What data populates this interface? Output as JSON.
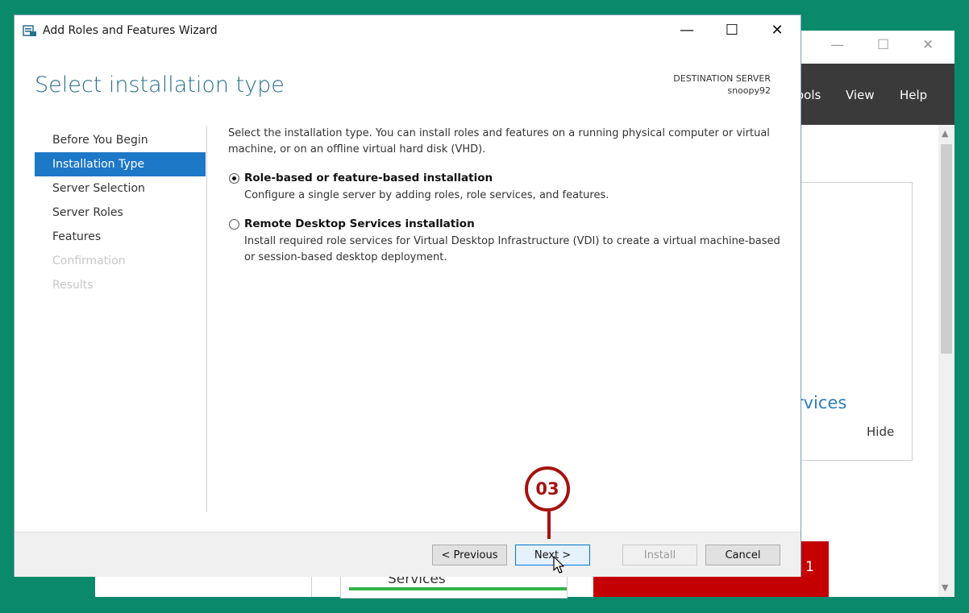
{
  "background_window": {
    "menu": [
      "ools",
      "View",
      "Help"
    ],
    "services_text": "rvices",
    "hide_label": "Hide",
    "tile_label": "Services",
    "red_tile_count": "1"
  },
  "wizard": {
    "title": "Add Roles and Features Wizard",
    "heading": "Select installation type",
    "destination_label": "DESTINATION SERVER",
    "destination_server": "snoopy92",
    "nav": [
      {
        "label": "Before You Begin",
        "state": "normal"
      },
      {
        "label": "Installation Type",
        "state": "active"
      },
      {
        "label": "Server Selection",
        "state": "normal"
      },
      {
        "label": "Server Roles",
        "state": "normal"
      },
      {
        "label": "Features",
        "state": "normal"
      },
      {
        "label": "Confirmation",
        "state": "disabled"
      },
      {
        "label": "Results",
        "state": "disabled"
      }
    ],
    "intro": "Select the installation type. You can install roles and features on a running physical computer or virtual machine, or on an offline virtual hard disk (VHD).",
    "options": [
      {
        "title": "Role-based or feature-based installation",
        "desc": "Configure a single server by adding roles, role services, and features.",
        "checked": true
      },
      {
        "title": "Remote Desktop Services installation",
        "desc": "Install required role services for Virtual Desktop Infrastructure (VDI) to create a virtual machine-based or session-based desktop deployment.",
        "checked": false
      }
    ],
    "buttons": {
      "previous": "< Previous",
      "next": "Next >",
      "install": "Install",
      "cancel": "Cancel"
    }
  },
  "annotation": {
    "step": "03"
  },
  "colors": {
    "accent": "#1e78c8",
    "heading": "#2a6f8e",
    "annotation": "#a6120d",
    "desktop": "#0b8a6b"
  }
}
